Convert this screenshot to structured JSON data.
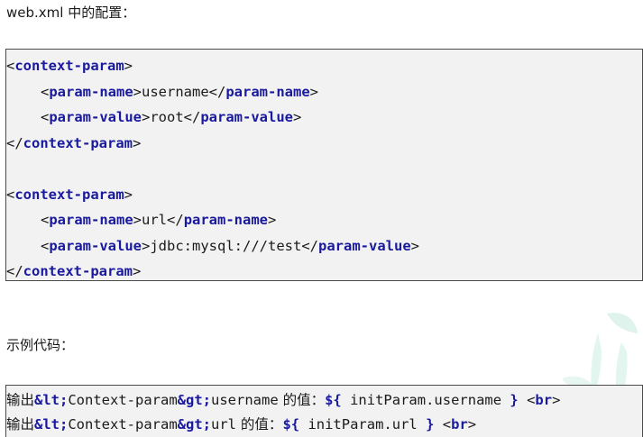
{
  "headings": {
    "config": "web.xml 中的配置：",
    "example": "示例代码："
  },
  "xml_block": {
    "blocks": [
      {
        "open_tag": "context-param",
        "name_tag": "param-name",
        "name_value": "username",
        "value_tag": "param-value",
        "value_value": "root",
        "close_tag": "context-param"
      },
      {
        "open_tag": "context-param",
        "name_tag": "param-name",
        "name_value": "url",
        "value_tag": "param-value",
        "value_value": "jdbc:mysql:///test",
        "close_tag": "context-param"
      }
    ]
  },
  "example_block": {
    "lines": [
      {
        "prefix": "输出",
        "lt": "&lt;",
        "mid": "Context-param",
        "gt": "&gt;",
        "name": "username",
        "label": " 的值：",
        "expr_open": "${",
        "expr": " initParam.username ",
        "expr_close": "}",
        "br": "<br>"
      },
      {
        "prefix": "输出",
        "lt": "&lt;",
        "mid": "Context-param",
        "gt": "&gt;",
        "name": "url",
        "label": " 的值：",
        "expr_open": "${",
        "expr": " initParam.url ",
        "expr_close": "}",
        "br": "<br>"
      }
    ]
  },
  "colors": {
    "keyword": "#1a1a9e",
    "code_bg": "#f2f2f2",
    "border": "#4a4a4a",
    "leaf_watermark": "#cfeee3"
  },
  "decoration": {
    "watermark_icon": "leaf-watermark-icon"
  }
}
